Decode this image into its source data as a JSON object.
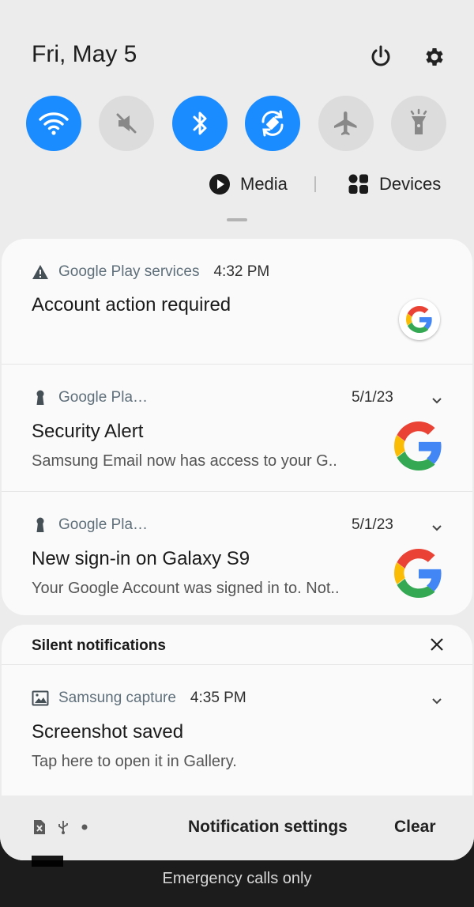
{
  "header": {
    "date": "Fri, May 5"
  },
  "quick_settings": [
    {
      "name": "wifi",
      "icon": "wifi-icon",
      "active": true
    },
    {
      "name": "sound",
      "icon": "mute-icon",
      "active": false
    },
    {
      "name": "bluetooth",
      "icon": "bluetooth-icon",
      "active": true
    },
    {
      "name": "auto-rotate",
      "icon": "rotate-icon",
      "active": true
    },
    {
      "name": "airplane",
      "icon": "airplane-icon",
      "active": false
    },
    {
      "name": "flashlight",
      "icon": "flashlight-icon",
      "active": false
    }
  ],
  "media_row": {
    "media_label": "Media",
    "devices_label": "Devices"
  },
  "notifications": [
    {
      "app": "Google Play services",
      "time": "4:32 PM",
      "title": "Account action required",
      "body": ""
    },
    {
      "app": "Google Pla…",
      "time": "5/1/23",
      "title": "Security Alert",
      "body": "Samsung Email now has access to your G.."
    },
    {
      "app": "Google Pla…",
      "time": "5/1/23",
      "title": "New sign-in on Galaxy S9",
      "body": "Your Google Account was signed in to. Not.."
    }
  ],
  "silent": {
    "header": "Silent notifications",
    "items": [
      {
        "app": "Samsung capture",
        "time": "4:35 PM",
        "title": "Screenshot saved",
        "body": "Tap here to open it in Gallery."
      }
    ]
  },
  "footer": {
    "settings_label": "Notification settings",
    "clear_label": "Clear"
  },
  "lockscreen": {
    "emergency_text": "Emergency calls only"
  },
  "colors": {
    "accent": "#1a8cff",
    "panel": "#ececec",
    "card": "#fafafa"
  }
}
